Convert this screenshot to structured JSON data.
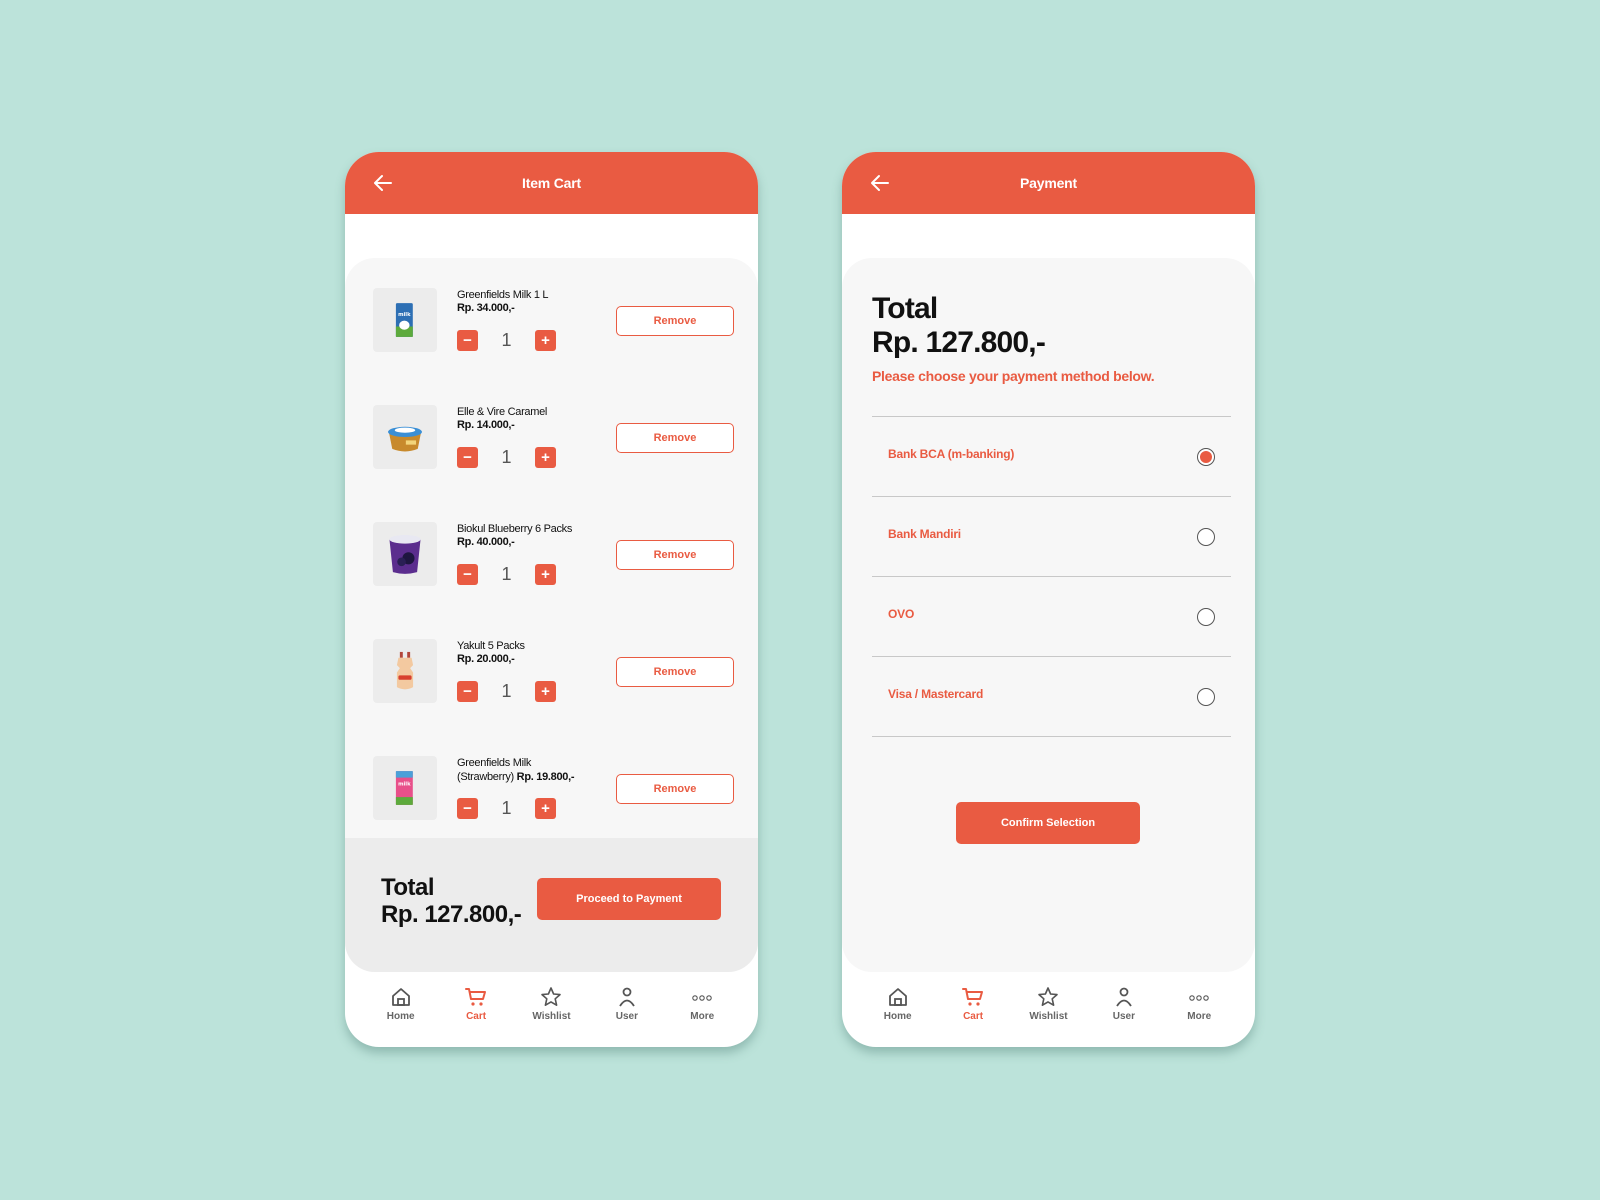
{
  "colors": {
    "background": "#bce3da",
    "accent": "#e95b42",
    "panel": "#f7f7f7",
    "total_bar": "#ececec"
  },
  "cart_screen": {
    "header": {
      "title": "Item Cart",
      "back_icon": "arrow-left-icon"
    },
    "items": [
      {
        "name": "Greenfields Milk 1 L",
        "price": "Rp. 34.000,-",
        "quantity": "1",
        "remove_label": "Remove",
        "image": "milk-carton-blue"
      },
      {
        "name": "Elle & Vire Caramel",
        "price": "Rp. 14.000,-",
        "quantity": "1",
        "remove_label": "Remove",
        "image": "caramel-cup"
      },
      {
        "name": "Biokul Blueberry 6 Packs",
        "price": "Rp. 40.000,-",
        "quantity": "1",
        "remove_label": "Remove",
        "image": "yogurt-tub-purple"
      },
      {
        "name": "Yakult 5 Packs",
        "price": "Rp. 20.000,-",
        "quantity": "1",
        "remove_label": "Remove",
        "image": "yakult-bottle"
      },
      {
        "name": "Greenfields Milk (Strawberry)",
        "price": "Rp. 19.800,-",
        "quantity": "1",
        "remove_label": "Remove",
        "image": "milk-carton-pink"
      }
    ],
    "qty_minus": "−",
    "qty_plus": "+",
    "total_label": "Total",
    "total_value": "Rp. 127.800,-",
    "proceed_label": "Proceed to Payment"
  },
  "payment_screen": {
    "header": {
      "title": "Payment",
      "back_icon": "arrow-left-icon"
    },
    "total_label": "Total",
    "total_value": "Rp. 127.800,-",
    "hint": "Please choose your payment method below.",
    "methods": [
      {
        "label": "Bank BCA (m-banking)",
        "selected": true
      },
      {
        "label": "Bank Mandiri",
        "selected": false
      },
      {
        "label": "OVO",
        "selected": false
      },
      {
        "label": "Visa / Mastercard",
        "selected": false
      }
    ],
    "confirm_label": "Confirm Selection"
  },
  "bottom_nav": {
    "items": [
      {
        "label": "Home",
        "icon": "home-icon",
        "active": false
      },
      {
        "label": "Cart",
        "icon": "cart-icon",
        "active": true
      },
      {
        "label": "Wishlist",
        "icon": "star-icon",
        "active": false
      },
      {
        "label": "User",
        "icon": "user-icon",
        "active": false
      },
      {
        "label": "More",
        "icon": "more-icon",
        "active": false
      }
    ]
  }
}
